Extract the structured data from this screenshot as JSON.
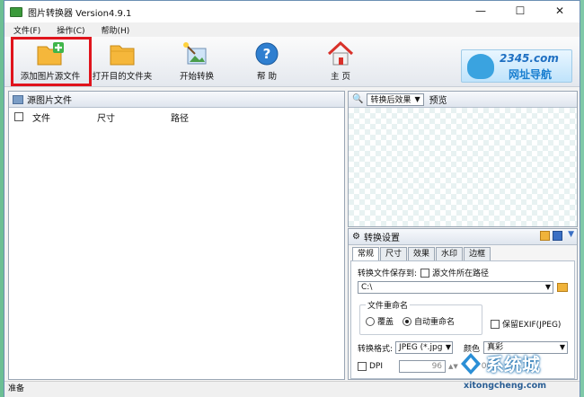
{
  "window": {
    "title": "图片转换器 Version4.9.1"
  },
  "menu": [
    "文件(F)",
    "操作(C)",
    "帮助(H)"
  ],
  "toolbar": {
    "add_source": "添加图片源文件",
    "open_dest": "打开目的文件夹",
    "start_convert": "开始转换",
    "help": "帮 助",
    "home": "主 页"
  },
  "brand": {
    "line1": "2345.com",
    "line2": "网址导航"
  },
  "source_panel": {
    "title": "源图片文件",
    "columns": [
      "文件",
      "尺寸",
      "路径"
    ]
  },
  "preview_panel": {
    "mode_selected": "转换后效果",
    "label": "预览"
  },
  "settings_panel": {
    "title": "转换设置",
    "tabs": [
      "常规",
      "尺寸",
      "效果",
      "水印",
      "边框"
    ],
    "save_to_label": "转换文件保存到:",
    "source_path_option": "源文件所在路径",
    "path_value": "C:\\",
    "rename_label": "文件重命名",
    "overwrite": "覆盖",
    "auto_rename": "自动重命名",
    "keep_exif": "保留EXIF(JPEG)",
    "format_label": "转换格式:",
    "format_value": "JPEG (*.jpg",
    "color_label": "颜色",
    "color_value": "真彩",
    "dpi_label": "DPI",
    "dpi_value": "96",
    "dpi_extra": "00"
  },
  "status": {
    "text": "准备"
  },
  "watermark": {
    "text": "系统城",
    "url": "xitongcheng.com"
  }
}
